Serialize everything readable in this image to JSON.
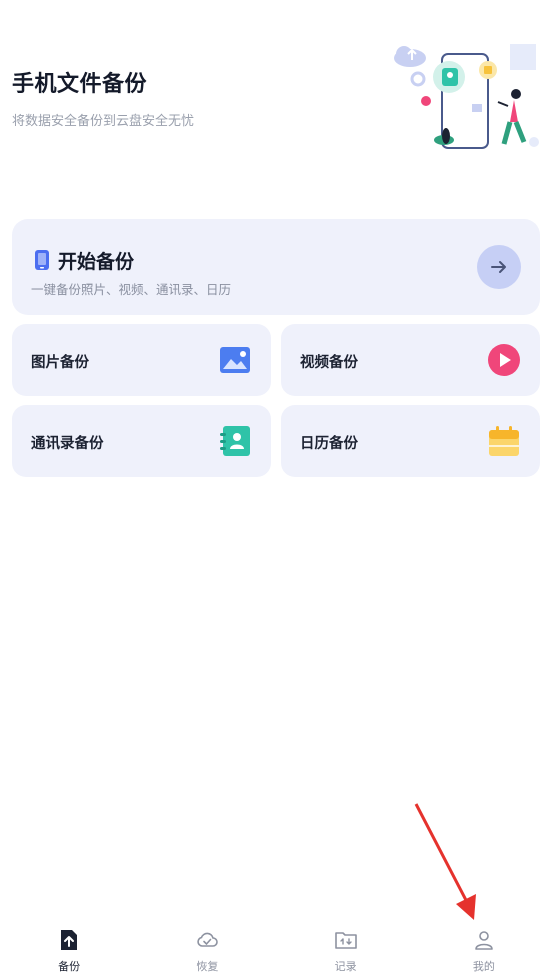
{
  "header": {
    "title": "手机文件备份",
    "subtitle": "将数据安全备份到云盘安全无忧"
  },
  "start_backup": {
    "title": "开始备份",
    "subtitle": "一键备份照片、视频、通讯录、日历"
  },
  "tiles": [
    {
      "label": "图片备份",
      "icon": "image-icon",
      "color": "#4c7df0"
    },
    {
      "label": "视频备份",
      "icon": "play-icon",
      "color": "#f0467a"
    },
    {
      "label": "通讯录备份",
      "icon": "contacts-icon",
      "color": "#2fc3a8"
    },
    {
      "label": "日历备份",
      "icon": "calendar-icon",
      "color": "#f7c23b"
    }
  ],
  "tabbar": {
    "items": [
      {
        "label": "备份",
        "icon": "backup-upload-icon",
        "active": true
      },
      {
        "label": "恢复",
        "icon": "cloud-check-icon",
        "active": false
      },
      {
        "label": "记录",
        "icon": "folder-transfer-icon",
        "active": false
      },
      {
        "label": "我的",
        "icon": "user-icon",
        "active": false
      }
    ]
  },
  "colors": {
    "card_bg": "#eff1fb",
    "accent_arrow_bg": "#c6cff5",
    "annotation": "#e5322d"
  }
}
